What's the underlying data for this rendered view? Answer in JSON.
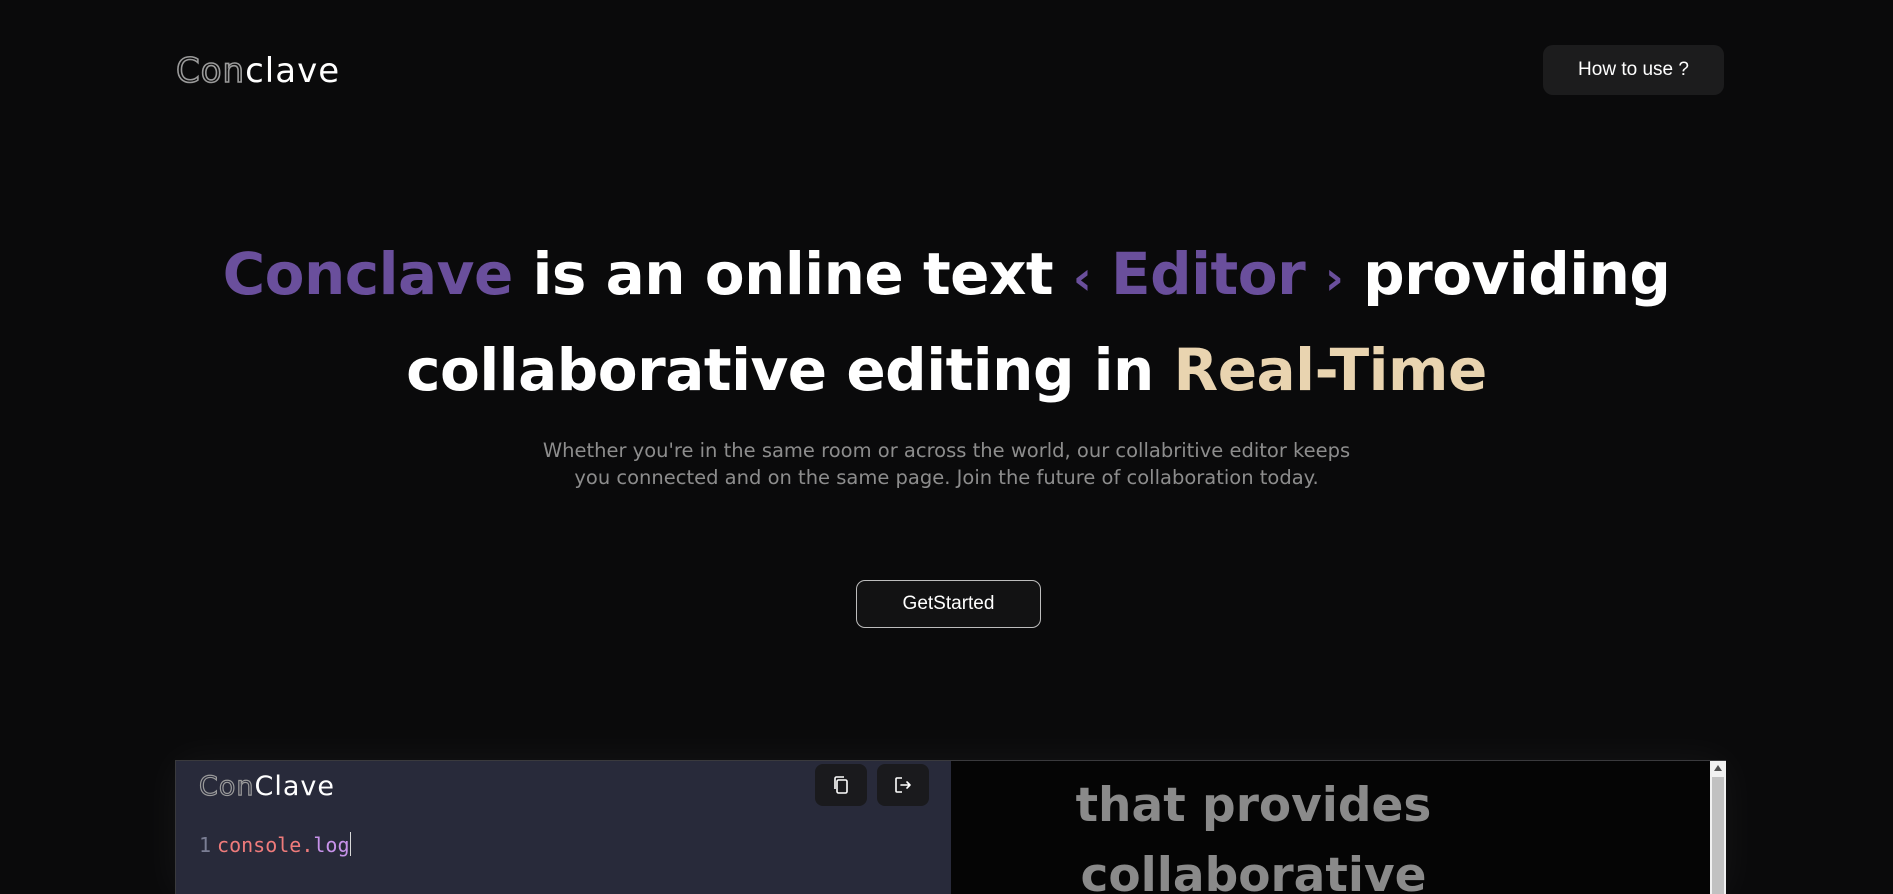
{
  "brand": {
    "logo_part1": "Con",
    "logo_part2": "clave"
  },
  "nav": {
    "how_to_use_label": "How to use ?"
  },
  "hero": {
    "headline_brand": "Conclave",
    "headline_mid": " is an online text ",
    "headline_open": "‹",
    "headline_editor": " Editor ",
    "headline_close": "›",
    "headline_end": " providing",
    "headline_line2_start": "collaborative editing in ",
    "headline_realtime": "Real-Time",
    "subtitle_line1": "Whether you're in the same room or across the world, our collabritive editor keeps",
    "subtitle_line2": "you connected and on the same page. Join the future of collaboration today.",
    "cta_label": "GetStarted"
  },
  "preview": {
    "editor_logo_part1": "Con",
    "editor_logo_part2": "Clave",
    "code_line_number": "1",
    "code_object": "console",
    "code_dot": ".",
    "code_method": "log",
    "output_line1": "that provides",
    "output_line2": "collaborative"
  },
  "colors": {
    "background": "#0a0a0b",
    "accent_purple": "#6a4f9c",
    "accent_gold": "#e9d4b0",
    "editor_bg": "#282a3a"
  },
  "icons": {
    "copy": "copy-icon",
    "leave": "logout-icon"
  }
}
